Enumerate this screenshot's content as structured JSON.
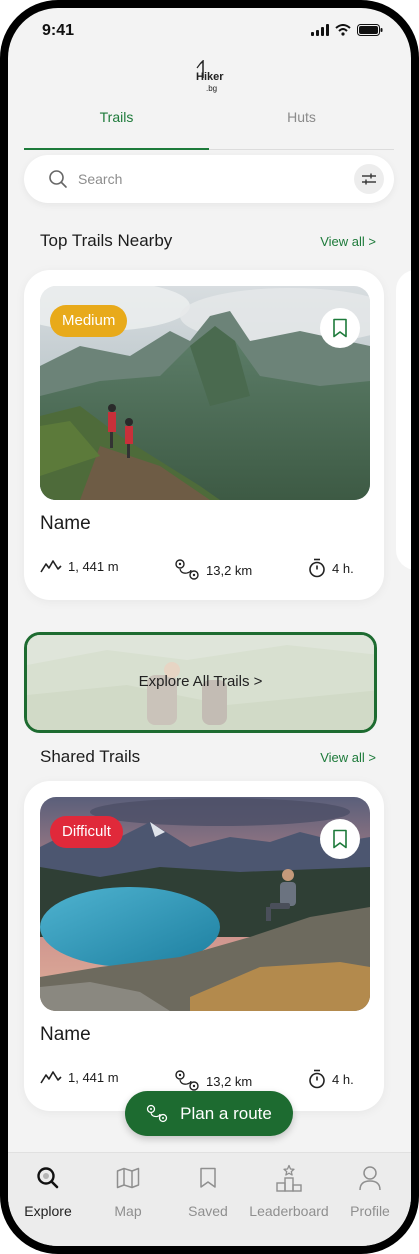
{
  "status_bar": {
    "time": "9:41"
  },
  "logo": {
    "line1": "Hiker",
    "line2": ".bg"
  },
  "tabs": [
    {
      "label": "Trails",
      "active": true
    },
    {
      "label": "Huts",
      "active": false
    }
  ],
  "search": {
    "placeholder": "Search"
  },
  "sections": {
    "top_trails": {
      "title": "Top Trails Nearby",
      "view_all": "View all >"
    },
    "shared_trails": {
      "title": "Shared Trails",
      "view_all": "View all >"
    }
  },
  "cards": [
    {
      "difficulty": "Medium",
      "difficulty_color": "#e8aa1a",
      "name": "Name",
      "elevation": "1, 441 m",
      "distance": "13,2 km",
      "duration": "4 h."
    },
    {
      "difficulty": "Difficult",
      "difficulty_color": "#e0293a",
      "name": "Name",
      "elevation": "1, 441 m",
      "distance": "13,2 km",
      "duration": "4 h."
    }
  ],
  "explore_banner": {
    "label": "Explore All Trails >"
  },
  "plan_route": {
    "label": "Plan a route"
  },
  "bottom_nav": [
    {
      "label": "Explore",
      "icon": "search-icon",
      "active": true
    },
    {
      "label": "Map",
      "icon": "map-icon",
      "active": false
    },
    {
      "label": "Saved",
      "icon": "bookmark-icon",
      "active": false
    },
    {
      "label": "Leaderboard",
      "icon": "podium-icon",
      "active": false
    },
    {
      "label": "Profile",
      "icon": "user-icon",
      "active": false
    }
  ],
  "colors": {
    "brand_green": "#1d7a3a",
    "button_green": "#1d6b30",
    "medium": "#e8aa1a",
    "difficult": "#e0293a"
  }
}
